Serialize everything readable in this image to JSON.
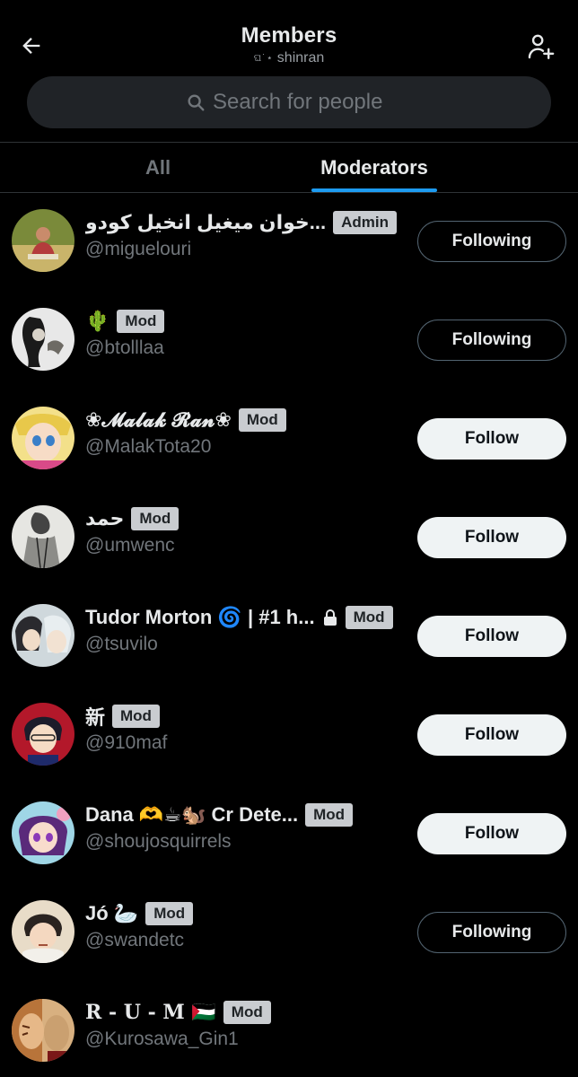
{
  "header": {
    "title": "Members",
    "subtitle_deco": "ଘ˙⋆",
    "subtitle": "shinran",
    "back_icon": "arrow-left-icon",
    "add_icon": "add-person-icon"
  },
  "search": {
    "placeholder": "Search for people"
  },
  "tabs": [
    {
      "label": "All",
      "active": false
    },
    {
      "label": "Moderators",
      "active": true
    }
  ],
  "colors": {
    "background": "#000000",
    "accent": "#1d9bf0",
    "badge_bg": "#c9ccd0",
    "muted_text": "#71767b",
    "follow_bg": "#eff3f4"
  },
  "members": [
    {
      "name": "خوان ميغيل انخيل كودو...",
      "handle": "@miguelouri",
      "badge": "Admin",
      "button": "Following",
      "button_state": "following",
      "lock": false
    },
    {
      "name": "🌵",
      "handle": "@btolllaa",
      "badge": "Mod",
      "button": "Following",
      "button_state": "following",
      "lock": false
    },
    {
      "name": "❀𝓜𝓪𝓵𝓪𝓴 𝓡𝓪𝓷❀",
      "handle": "@MalakTota20",
      "badge": "Mod",
      "button": "Follow",
      "button_state": "follow",
      "lock": false
    },
    {
      "name": "حمد",
      "handle": "@umwenc",
      "badge": "Mod",
      "button": "Follow",
      "button_state": "follow",
      "lock": false
    },
    {
      "name": "Tudor Morton 🌀 | #1 h...",
      "handle": "@tsuvilo",
      "badge": "Mod",
      "button": "Follow",
      "button_state": "follow",
      "lock": true
    },
    {
      "name": "新",
      "handle": "@910maf",
      "badge": "Mod",
      "button": "Follow",
      "button_state": "follow",
      "lock": false
    },
    {
      "name": "Dana 🫶☕🐿️ Cr Dete...",
      "handle": "@shoujosquirrels",
      "badge": "Mod",
      "button": "Follow",
      "button_state": "follow",
      "lock": false
    },
    {
      "name": "Jó 🦢",
      "handle": "@swandetc",
      "badge": "Mod",
      "button": "Following",
      "button_state": "following",
      "lock": false
    },
    {
      "name": "R - U - M 🇵🇸",
      "handle": "@Kurosawa_Gin1",
      "badge": "Mod",
      "button": "",
      "button_state": "",
      "lock": false
    }
  ]
}
